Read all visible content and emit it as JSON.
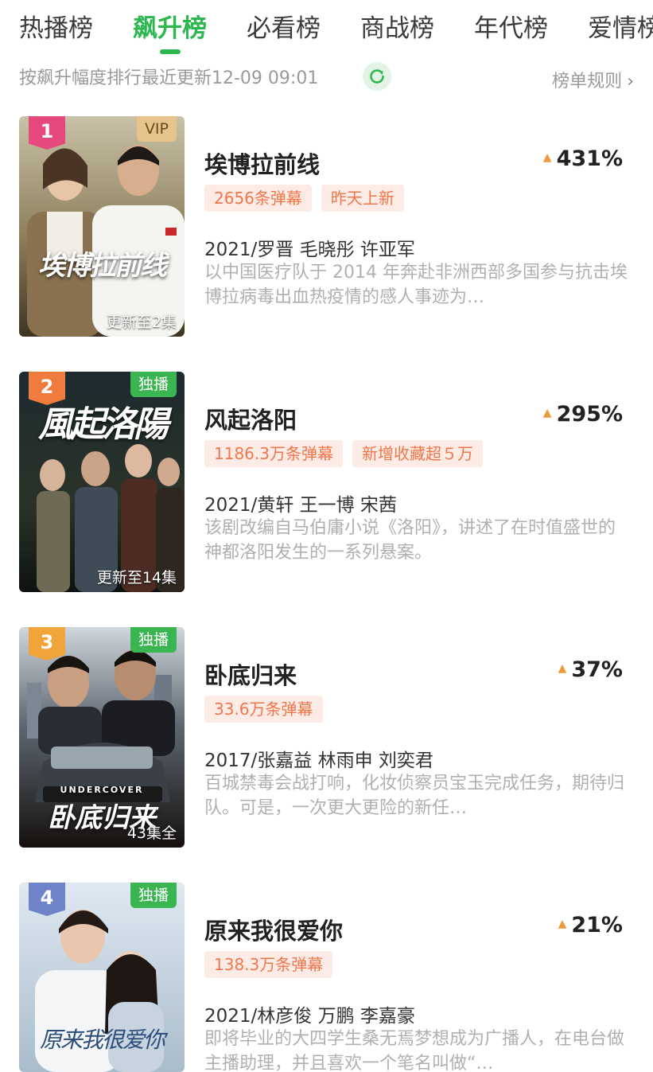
{
  "tabs": [
    {
      "label": "热播榜",
      "active": false
    },
    {
      "label": "飙升榜",
      "active": true
    },
    {
      "label": "必看榜",
      "active": false
    },
    {
      "label": "商战榜",
      "active": false
    },
    {
      "label": "年代榜",
      "active": false
    },
    {
      "label": "爱情榜",
      "active": false
    }
  ],
  "subbar": {
    "sort_desc": "按飙升幅度排行最近更新12-09 09:01",
    "refresh_icon": "refresh-icon",
    "rules_label": "榜单规则",
    "rules_chevron": "›"
  },
  "colors": {
    "accent": "#2db84f",
    "chip_bg": "#fdece5",
    "chip_text": "#f0764c",
    "rank1": "#e8497d",
    "rank2": "#ef7b3f",
    "rank3": "#f0a43a",
    "rank4": "#6f83c9",
    "vip_badge": "#e8c48d",
    "exclusive_badge": "#3bb552",
    "growth_arrow": "#ef9a3a"
  },
  "items": [
    {
      "rank": "1",
      "badge": "VIP",
      "poster_title": "埃博拉前线",
      "update": "更新至2集",
      "title": "埃博拉前线",
      "growth": "431%",
      "chips": [
        "2656条弹幕",
        "昨天上新"
      ],
      "meta": "2021/罗晋 毛晓彤 许亚军",
      "desc": "以中国医疗队于 2014 年奔赴非洲西部多国参与抗击埃博拉病毒出血热疫情的感人事迹为…"
    },
    {
      "rank": "2",
      "badge": "独播",
      "poster_title": "風起洛陽",
      "update": "更新至14集",
      "title": "风起洛阳",
      "growth": "295%",
      "chips": [
        "1186.3万条弹幕",
        "新增收藏超５万"
      ],
      "meta": "2021/黄轩 王一博 宋茜",
      "desc": "该剧改编自马伯庸小说《洛阳》，讲述了在时值盛世的神都洛阳发生的一系列悬案。"
    },
    {
      "rank": "3",
      "badge": "独播",
      "poster_title": "卧底归来",
      "poster_subtitle": "UNDERCOVER",
      "update": "43集全",
      "title": "卧底归来",
      "growth": "37%",
      "chips": [
        "33.6万条弹幕"
      ],
      "meta": "2017/张嘉益 林雨申 刘奕君",
      "desc": "百城禁毒会战打响，化妆侦察员宝玉完成任务，期待归队。可是，一次更大更险的新任…"
    },
    {
      "rank": "4",
      "badge": "独播",
      "poster_title": "原来我很爱你",
      "update": "",
      "title": "原来我很爱你",
      "growth": "21%",
      "chips": [
        "138.3万条弹幕"
      ],
      "meta": "2021/林彦俊 万鹏 李嘉豪",
      "desc": "即将毕业的大四学生桑无焉梦想成为广播人，在电台做主播助理，并且喜欢一个笔名叫做“…"
    }
  ]
}
